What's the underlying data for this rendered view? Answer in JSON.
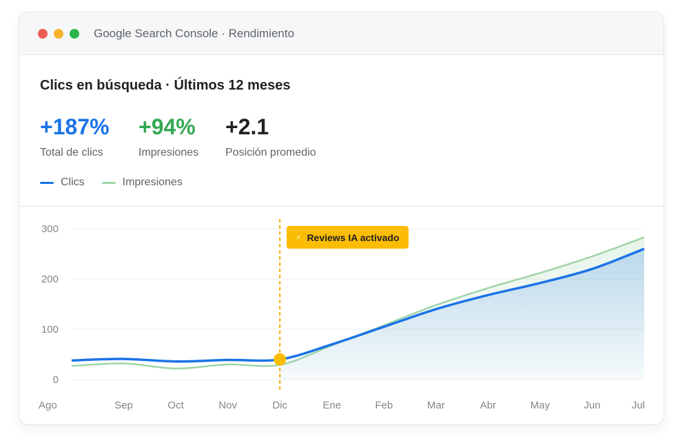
{
  "window": {
    "title": "Google Search Console · Rendimiento"
  },
  "header": {
    "title": "Clics en búsqueda · Últimos 12 meses",
    "metrics": [
      {
        "value": "+187%",
        "label": "Total de clics",
        "color": "#1a73e8"
      },
      {
        "value": "+94%",
        "label": "Impresiones",
        "color": "#34a853"
      },
      {
        "value": "+2.1",
        "label": "Posición promedio",
        "color": "#202124"
      }
    ],
    "legend": [
      {
        "label": "Clics",
        "color": "#1a73e8"
      },
      {
        "label": "Impresiones",
        "color": "#9ed5a8"
      }
    ]
  },
  "chart_data": {
    "type": "line",
    "x": [
      "Ago",
      "Sep",
      "Oct",
      "Nov",
      "Dic",
      "Ene",
      "Feb",
      "Mar",
      "Abr",
      "May",
      "Jun",
      "Jul"
    ],
    "series": [
      {
        "name": "Clics",
        "values": [
          38,
          41,
          36,
          39,
          40,
          70,
          105,
          140,
          168,
          192,
          220,
          260
        ],
        "color": "#1a73e8"
      },
      {
        "name": "Impresiones",
        "values": [
          27,
          32,
          22,
          30,
          29,
          68,
          108,
          148,
          182,
          212,
          245,
          283
        ],
        "color": "#9ed5a8"
      }
    ],
    "yticks": [
      0,
      100,
      200,
      300
    ],
    "ylim": [
      0,
      300
    ],
    "highlight_category": "Dic",
    "highlight_color": "#f9ab00",
    "annotation": {
      "label": "Reviews IA activado",
      "at": "Dic"
    },
    "grid": true
  }
}
